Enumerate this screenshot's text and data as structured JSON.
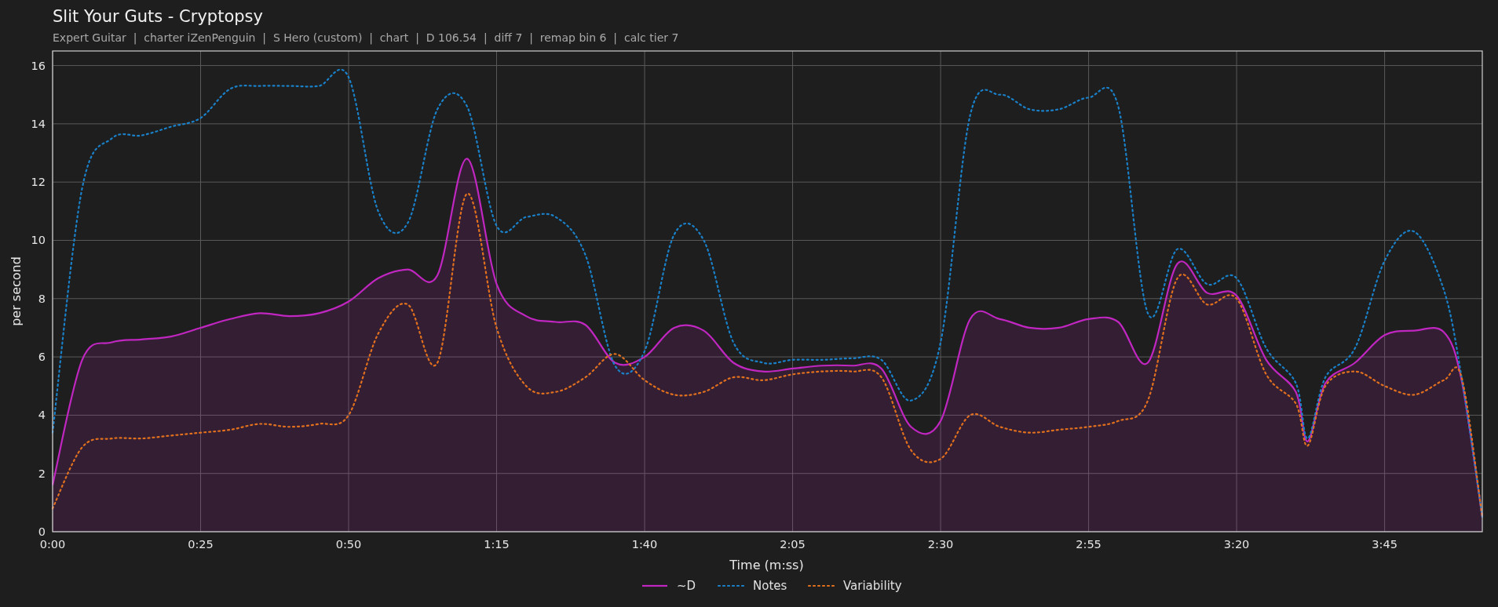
{
  "subtitle": "Expert Guitar  |  charter iZenPenguin  |  S Hero (custom)  |  chart  |  D 106.54  |  diff 7  |  remap bin 6  |  calc tier 7",
  "chart_data": {
    "type": "line",
    "title": "Slit Your Guts - Cryptopsy",
    "xlabel": "Time (m:ss)",
    "ylabel": "per second",
    "x": [
      0,
      5,
      10,
      15,
      20,
      25,
      30,
      35,
      40,
      45,
      50,
      55,
      60,
      65,
      70,
      75,
      80,
      85,
      90,
      95,
      100,
      105,
      110,
      115,
      120,
      125,
      130,
      135,
      140,
      145,
      150,
      155,
      160,
      165,
      170,
      175,
      180,
      185,
      190,
      195,
      200,
      205,
      210,
      212,
      215,
      220,
      225,
      230,
      235,
      238,
      241.5
    ],
    "series": [
      {
        "name": "~D",
        "color": "#c026c0",
        "type": "area",
        "line_style": "solid",
        "values": [
          1.6,
          5.9,
          6.5,
          6.6,
          6.7,
          7.0,
          7.3,
          7.5,
          7.4,
          7.5,
          7.9,
          8.7,
          9.0,
          8.8,
          12.8,
          8.5,
          7.4,
          7.2,
          7.1,
          5.8,
          6.0,
          7.0,
          6.9,
          5.8,
          5.5,
          5.6,
          5.7,
          5.7,
          5.6,
          3.6,
          3.8,
          7.3,
          7.3,
          7.0,
          7.0,
          7.3,
          7.2,
          5.8,
          9.2,
          8.2,
          8.1,
          5.9,
          4.8,
          3.1,
          5.1,
          5.8,
          6.75,
          6.9,
          6.85,
          5.2,
          0.5
        ]
      },
      {
        "name": "Notes",
        "color": "#1a80c8",
        "line_style": "dotted",
        "values": [
          3.4,
          11.8,
          13.5,
          13.6,
          13.9,
          14.2,
          15.2,
          15.3,
          15.3,
          15.3,
          15.6,
          11.0,
          10.6,
          14.5,
          14.6,
          10.5,
          10.8,
          10.8,
          9.5,
          5.7,
          6.2,
          10.2,
          10.0,
          6.5,
          5.8,
          5.9,
          5.9,
          5.95,
          5.9,
          4.5,
          6.5,
          14.3,
          15.0,
          14.5,
          14.5,
          14.9,
          14.6,
          7.5,
          9.7,
          8.5,
          8.7,
          6.3,
          5.1,
          3.2,
          5.3,
          6.3,
          9.3,
          10.3,
          8.3,
          5.3,
          0.5
        ]
      },
      {
        "name": "Variability",
        "color": "#e0701e",
        "line_style": "dotted",
        "values": [
          0.8,
          2.9,
          3.2,
          3.2,
          3.3,
          3.4,
          3.5,
          3.7,
          3.6,
          3.7,
          4.0,
          6.8,
          7.8,
          5.8,
          11.6,
          7.0,
          5.0,
          4.8,
          5.3,
          6.1,
          5.2,
          4.7,
          4.8,
          5.3,
          5.2,
          5.4,
          5.5,
          5.5,
          5.3,
          2.8,
          2.5,
          4.0,
          3.6,
          3.4,
          3.5,
          3.6,
          3.8,
          4.5,
          8.7,
          7.8,
          8.0,
          5.4,
          4.4,
          2.95,
          5.0,
          5.5,
          5.0,
          4.7,
          5.2,
          5.3,
          0.5
        ]
      }
    ],
    "grid": true,
    "legend": true,
    "xlim": [
      0,
      241.5
    ],
    "ylim": [
      0,
      16.5
    ],
    "xticks": [
      {
        "value": 0,
        "label": "0:00"
      },
      {
        "value": 25,
        "label": "0:25"
      },
      {
        "value": 50,
        "label": "0:50"
      },
      {
        "value": 75,
        "label": "1:15"
      },
      {
        "value": 100,
        "label": "1:40"
      },
      {
        "value": 125,
        "label": "2:05"
      },
      {
        "value": 150,
        "label": "2:30"
      },
      {
        "value": 175,
        "label": "2:55"
      },
      {
        "value": 200,
        "label": "3:20"
      },
      {
        "value": 225,
        "label": "3:45"
      }
    ],
    "yticks": [
      0,
      2,
      4,
      6,
      8,
      10,
      12,
      14,
      16
    ]
  }
}
